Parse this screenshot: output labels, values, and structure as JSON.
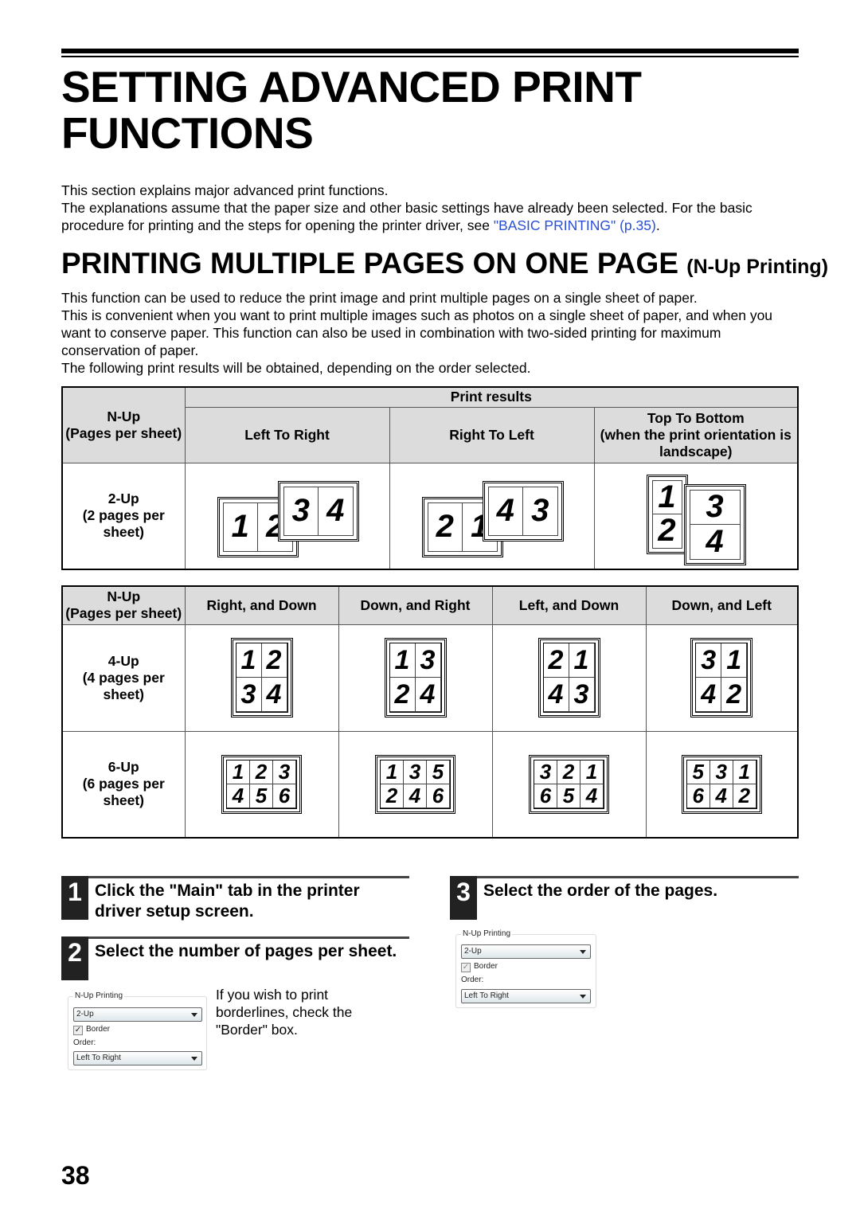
{
  "title": "SETTING ADVANCED PRINT FUNCTIONS",
  "intro": {
    "line1": "This section explains major advanced print functions.",
    "line2": "The explanations assume that the paper size and other basic settings have already been selected. For the basic procedure for printing and the steps for opening the printer driver, see ",
    "link": "\"BASIC PRINTING\" (p.35)",
    "end": "."
  },
  "section": {
    "title": "PRINTING MULTIPLE PAGES ON ONE PAGE",
    "subtitle": "(N-Up Printing)",
    "p1": "This function can be used to reduce the print image and print multiple pages on a single sheet of paper.",
    "p2": "This is convenient when you want to print multiple images such as photos on a single sheet of paper, and when you want to conserve paper. This function can also be used in combination with two-sided printing for maximum conservation of paper.",
    "p3": "The following print results will be obtained, depending on the order selected."
  },
  "table1": {
    "nup_header": "N-Up\n(Pages per sheet)",
    "print_results": "Print results",
    "cols": [
      "Left To Right",
      "Right To Left",
      "Top To Bottom\n(when the print orientation is landscape)"
    ],
    "row_label": "2-Up\n(2 pages per sheet)",
    "ltr": [
      [
        "1",
        "2"
      ],
      [
        "3",
        "4"
      ]
    ],
    "rtl": [
      [
        "2",
        "1"
      ],
      [
        "4",
        "3"
      ]
    ],
    "ttb": [
      [
        "1",
        "2"
      ],
      [
        "3",
        "4"
      ]
    ]
  },
  "table2": {
    "nup_header": "N-Up\n(Pages per sheet)",
    "cols": [
      "Right, and Down",
      "Down, and Right",
      "Left, and Down",
      "Down, and Left"
    ],
    "rows": [
      {
        "label": "4-Up\n(4 pages per sheet)",
        "grids": [
          [
            [
              "1",
              "2"
            ],
            [
              "3",
              "4"
            ]
          ],
          [
            [
              "1",
              "3"
            ],
            [
              "2",
              "4"
            ]
          ],
          [
            [
              "2",
              "1"
            ],
            [
              "4",
              "3"
            ]
          ],
          [
            [
              "3",
              "1"
            ],
            [
              "4",
              "2"
            ]
          ]
        ]
      },
      {
        "label": "6-Up\n(6 pages per sheet)",
        "grids": [
          [
            [
              "1",
              "2",
              "3"
            ],
            [
              "4",
              "5",
              "6"
            ]
          ],
          [
            [
              "1",
              "3",
              "5"
            ],
            [
              "2",
              "4",
              "6"
            ]
          ],
          [
            [
              "3",
              "2",
              "1"
            ],
            [
              "6",
              "5",
              "4"
            ]
          ],
          [
            [
              "5",
              "3",
              "1"
            ],
            [
              "6",
              "4",
              "2"
            ]
          ]
        ]
      }
    ]
  },
  "steps": [
    {
      "num": "1",
      "text": "Click the \"Main\" tab in the printer driver setup screen."
    },
    {
      "num": "2",
      "text": "Select the number of pages per sheet."
    },
    {
      "num": "3",
      "text": "Select the order of the pages."
    }
  ],
  "step2_note": "If you wish to print borderlines, check the \"Border\" box.",
  "dialog": {
    "group": "N-Up Printing",
    "nup_value": "2-Up",
    "border_label": "Border",
    "border_checked": true,
    "order_label": "Order:",
    "order_value": "Left To Right"
  },
  "page_number": "38"
}
